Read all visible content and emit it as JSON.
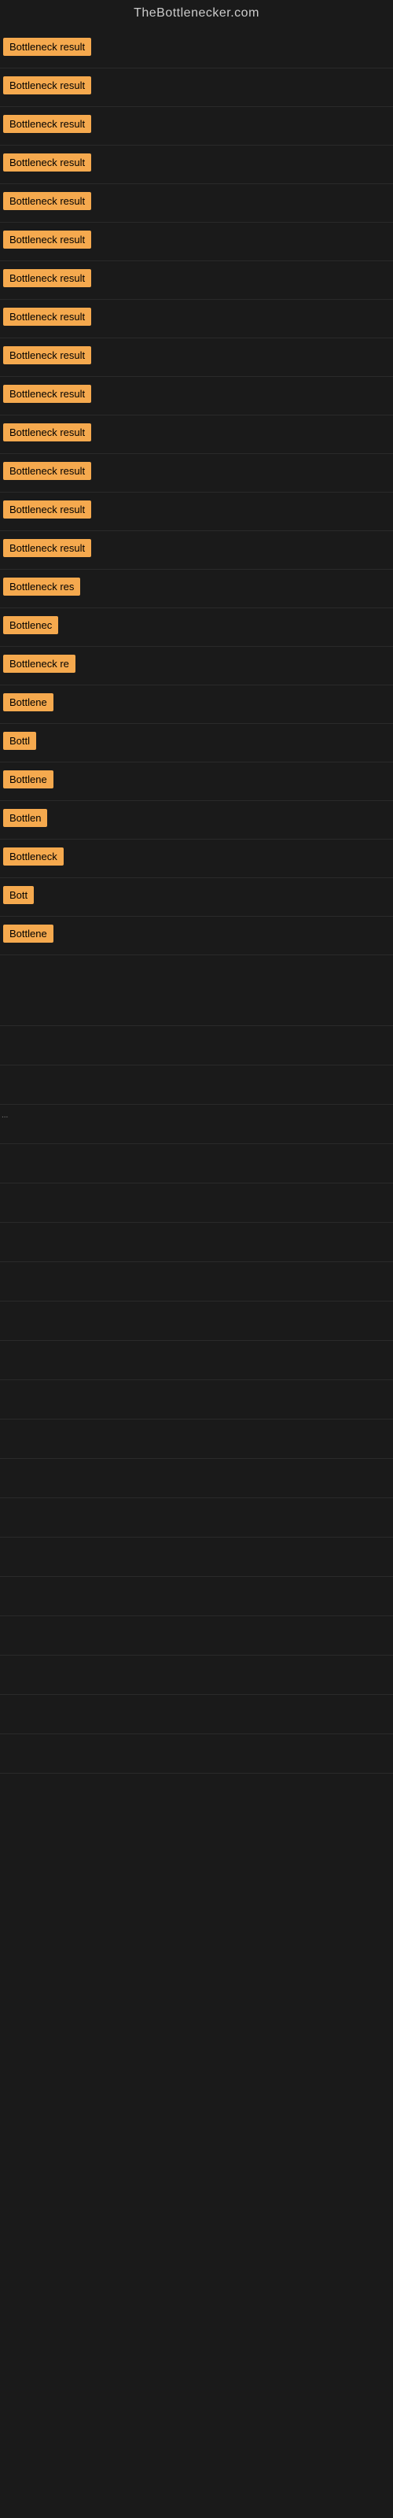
{
  "site": {
    "title": "TheBottlenecker.com"
  },
  "rows": [
    {
      "id": 1,
      "label": "Bottleneck result",
      "width": 130,
      "truncated": false
    },
    {
      "id": 2,
      "label": "Bottleneck result",
      "width": 130,
      "truncated": false
    },
    {
      "id": 3,
      "label": "Bottleneck result",
      "width": 130,
      "truncated": false
    },
    {
      "id": 4,
      "label": "Bottleneck result",
      "width": 130,
      "truncated": false
    },
    {
      "id": 5,
      "label": "Bottleneck result",
      "width": 130,
      "truncated": false
    },
    {
      "id": 6,
      "label": "Bottleneck result",
      "width": 130,
      "truncated": false
    },
    {
      "id": 7,
      "label": "Bottleneck result",
      "width": 130,
      "truncated": false
    },
    {
      "id": 8,
      "label": "Bottleneck result",
      "width": 130,
      "truncated": false
    },
    {
      "id": 9,
      "label": "Bottleneck result",
      "width": 130,
      "truncated": false
    },
    {
      "id": 10,
      "label": "Bottleneck result",
      "width": 130,
      "truncated": false
    },
    {
      "id": 11,
      "label": "Bottleneck result",
      "width": 130,
      "truncated": false
    },
    {
      "id": 12,
      "label": "Bottleneck result",
      "width": 130,
      "truncated": false
    },
    {
      "id": 13,
      "label": "Bottleneck result",
      "width": 130,
      "truncated": false
    },
    {
      "id": 14,
      "label": "Bottleneck result",
      "width": 130,
      "truncated": false
    },
    {
      "id": 15,
      "label": "Bottleneck res",
      "width": 110,
      "truncated": true
    },
    {
      "id": 16,
      "label": "Bottlenec",
      "width": 75,
      "truncated": true
    },
    {
      "id": 17,
      "label": "Bottleneck re",
      "width": 100,
      "truncated": true
    },
    {
      "id": 18,
      "label": "Bottlene",
      "width": 68,
      "truncated": true
    },
    {
      "id": 19,
      "label": "Bottl",
      "width": 48,
      "truncated": true
    },
    {
      "id": 20,
      "label": "Bottlene",
      "width": 68,
      "truncated": true
    },
    {
      "id": 21,
      "label": "Bottlen",
      "width": 60,
      "truncated": true
    },
    {
      "id": 22,
      "label": "Bottleneck",
      "width": 82,
      "truncated": true
    },
    {
      "id": 23,
      "label": "Bott",
      "width": 40,
      "truncated": true
    },
    {
      "id": 24,
      "label": "Bottlene",
      "width": 68,
      "truncated": true
    }
  ],
  "bottom_marker": "...",
  "accent_color": "#f5a94e"
}
